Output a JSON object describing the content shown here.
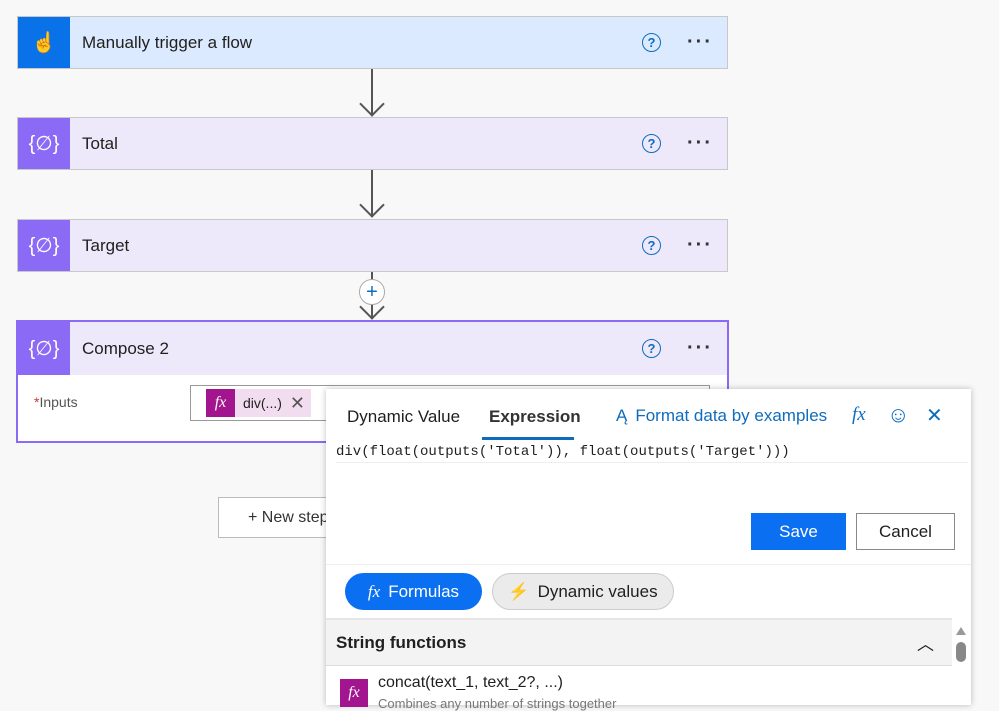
{
  "steps": [
    {
      "title": "Manually trigger a flow",
      "icon": "touch-icon"
    },
    {
      "title": "Total",
      "icon": "variable-icon"
    },
    {
      "title": "Target",
      "icon": "variable-icon"
    }
  ],
  "compose": {
    "title": "Compose 2",
    "inputs_label": "Inputs",
    "required": "*",
    "token": "div(...)"
  },
  "new_step": "+ New step",
  "panel": {
    "tabs": [
      "Dynamic Value",
      "Expression"
    ],
    "format_link": "Format data by examples",
    "expression": "div(float(outputs('Total')), float(outputs('Target')))",
    "save": "Save",
    "cancel": "Cancel",
    "formulas": "Formulas",
    "dynamic_values": "Dynamic values",
    "section": "String functions",
    "functions": [
      {
        "name": "concat(text_1, text_2?, ...)",
        "desc": "Combines any number of strings together"
      }
    ]
  },
  "colors": {
    "accent": "#0f6cbd",
    "primary": "#0a72e9",
    "variable": "#8b6af5",
    "fx": "#a3158f"
  }
}
